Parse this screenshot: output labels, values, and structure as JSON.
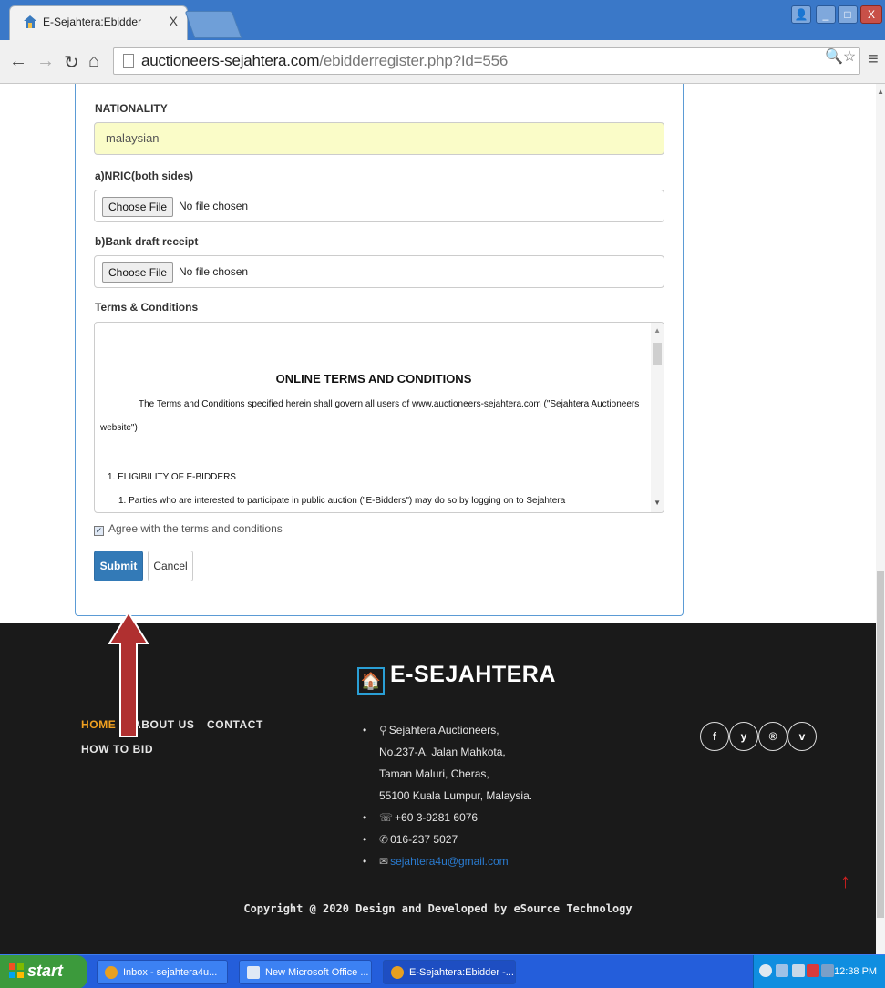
{
  "browser": {
    "tab_title": "E-Sejahtera:Ebidder",
    "tab_close": "X",
    "url_domain": "auctioneers-sejahtera.com",
    "url_path": "/ebidderregister.php?Id=556",
    "window_buttons": [
      "_",
      "□",
      "X"
    ]
  },
  "form": {
    "nationality_label": "NATIONALITY",
    "nationality_value": "malaysian",
    "nric_label": "a)NRIC(both sides)",
    "bank_label": "b)Bank draft receipt",
    "choose_file": "Choose File",
    "no_file": "No file chosen",
    "terms_label": "Terms & Conditions",
    "terms": {
      "heading": "ONLINE TERMS AND CONDITIONS",
      "para1": "The Terms and Conditions specified herein shall govern all users of www.auctioneers-sejahtera.com (\"Sejahtera Auctioneers",
      "para1_cont": "website\")",
      "section1": "1.   ELIGIBILITY OF E-BIDDERS",
      "item1": "1. Parties who are interested to participate in public auction (\"E-Bidders\") may do so by logging on to Sejahtera"
    },
    "agree_label": "Agree with the terms and conditions",
    "agree_checked": true,
    "submit": "Submit",
    "cancel": "Cancel"
  },
  "footer": {
    "brand": "E-SEJAHTERA",
    "nav": [
      {
        "label": "HOME",
        "active": true
      },
      {
        "label": "ABOUT US",
        "active": false
      },
      {
        "label": "CONTACT",
        "active": false
      },
      {
        "label": "HOW TO BID",
        "active": false
      }
    ],
    "address_lines": [
      "Sejahtera Auctioneers,",
      "No.237-A, Jalan Mahkota,",
      "Taman Maluri, Cheras,",
      "55100 Kuala Lumpur, Malaysia."
    ],
    "phone": "+60 3-9281 6076",
    "whatsapp": "016-237 5027",
    "email": "sejahtera4u@gmail.com",
    "social": [
      "f",
      "y",
      "®",
      "v"
    ],
    "copyright": "Copyright @ 2020 Design and Developed by eSource Technology"
  },
  "taskbar": {
    "start": "start",
    "tasks": [
      {
        "label": "Inbox - sejahtera4u...",
        "active": false
      },
      {
        "label": "New Microsoft Office ...",
        "active": false
      },
      {
        "label": "E-Sejahtera:Ebidder -...",
        "active": true
      }
    ],
    "clock": "12:38 PM"
  },
  "colors": {
    "accent": "#337ab7",
    "card_border": "#5b9bd5",
    "highlight_input": "#fafcc8",
    "footer_bg": "#1a1a1a",
    "nav_active": "#f0a020",
    "annotation_arrow": "#b03030"
  }
}
